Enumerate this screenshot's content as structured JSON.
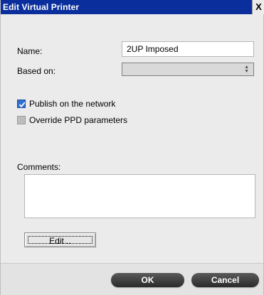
{
  "window": {
    "title": "Edit Virtual Printer",
    "close_glyph": "X"
  },
  "form": {
    "name_label": "Name:",
    "name_value": "2UP Imposed",
    "based_on_label": "Based on:",
    "based_on_value": "",
    "publish_label": "Publish on the network",
    "publish_checked": true,
    "override_label": "Override PPD parameters",
    "override_checked": false,
    "comments_label": "Comments:",
    "comments_value": "",
    "edit_button": "Edit..."
  },
  "footer": {
    "ok_label": "OK",
    "cancel_label": "Cancel"
  },
  "colors": {
    "titlebar": "#0a2f9c",
    "checkbox_checked": "#2f6fcf",
    "pill_button": "#333333"
  }
}
